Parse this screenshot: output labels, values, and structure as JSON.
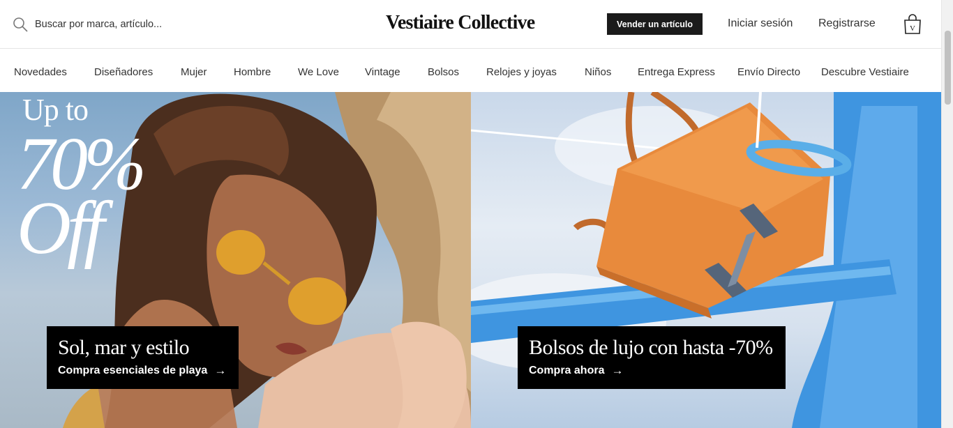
{
  "header": {
    "search_placeholder": "Buscar por marca, artículo...",
    "logo": "Vestiaire Collective",
    "sell_button": "Vender un artículo",
    "login": "Iniciar sesión",
    "register": "Registrarse",
    "bag_letter": "V"
  },
  "nav": {
    "items": [
      "Novedades",
      "Diseñadores",
      "Mujer",
      "Hombre",
      "We Love",
      "Vintage",
      "Bolsos",
      "Relojes y joyas",
      "Niños",
      "Entrega Express",
      "Envío Directo",
      "Descubre Vestiaire"
    ]
  },
  "banners": {
    "left": {
      "promo_line1": "Up to",
      "promo_line2": "70%",
      "promo_line3": "Off",
      "title": "Sol, mar y estilo",
      "cta": "Compra esenciales de playa",
      "arrow": "→"
    },
    "right": {
      "title": "Bolsos de lujo con hasta -70%",
      "cta": "Compra ahora",
      "arrow": "→"
    }
  },
  "colors": {
    "button_bg": "#1b1b1b",
    "cta_bg": "#000000",
    "bag_orange": "#e88a3c",
    "pole_blue": "#3f95e0"
  }
}
